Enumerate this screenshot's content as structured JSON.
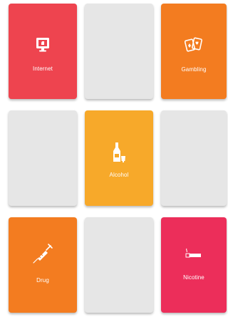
{
  "tiles": [
    {
      "id": "internet",
      "label": "Internet",
      "icon": "computer-monitor-icon",
      "color": "#ee444f"
    },
    {
      "id": "gambling",
      "label": "Gambling",
      "icon": "playing-cards-icon",
      "color": "#f37c20"
    },
    {
      "id": "alcohol",
      "label": "Alcohol",
      "icon": "bottle-and-glass-icon",
      "color": "#f7a92a"
    },
    {
      "id": "drug",
      "label": "Drug",
      "icon": "syringe-icon",
      "color": "#f37c20"
    },
    {
      "id": "nicotine",
      "label": "Nicotine",
      "icon": "cigarette-icon",
      "color": "#ec2e5a"
    }
  ],
  "empty_color": "#e6e6e6"
}
